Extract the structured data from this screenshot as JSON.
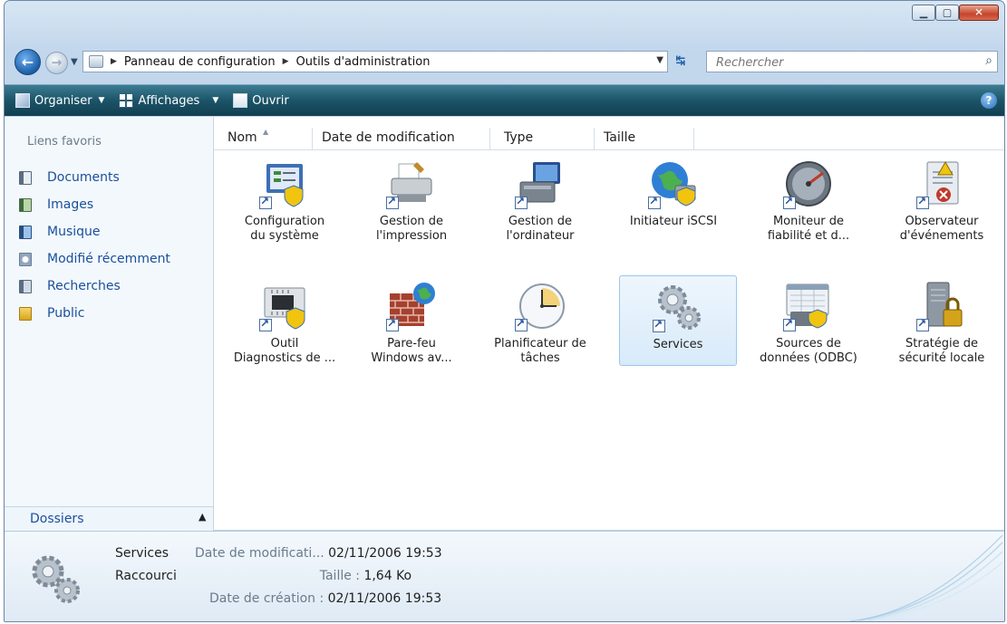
{
  "address": {
    "crumbs": [
      "Panneau de configuration",
      "Outils d'administration"
    ]
  },
  "search": {
    "placeholder": "Rechercher"
  },
  "toolbar": {
    "organize": "Organiser",
    "views": "Affichages",
    "open": "Ouvrir"
  },
  "sidebar": {
    "favorites_title": "Liens favoris",
    "items": [
      {
        "label": "Documents",
        "icon": "documents-icon"
      },
      {
        "label": "Images",
        "icon": "images-icon"
      },
      {
        "label": "Musique",
        "icon": "music-icon"
      },
      {
        "label": "Modifié récemment",
        "icon": "recent-icon"
      },
      {
        "label": "Recherches",
        "icon": "searches-icon"
      },
      {
        "label": "Public",
        "icon": "public-folder-icon"
      }
    ],
    "folders_label": "Dossiers"
  },
  "columns": [
    "Nom",
    "Date de modification",
    "Type",
    "Taille"
  ],
  "items": [
    {
      "line1": "Configuration",
      "line2": "du système",
      "icon": "system-config-icon"
    },
    {
      "line1": "Gestion de",
      "line2": "l'impression",
      "icon": "printer-icon"
    },
    {
      "line1": "Gestion de",
      "line2": "l'ordinateur",
      "icon": "computer-management-icon"
    },
    {
      "line1": "Initiateur iSCSI",
      "line2": "",
      "icon": "iscsi-globe-icon"
    },
    {
      "line1": "Moniteur de",
      "line2": "fiabilité et d...",
      "icon": "gauge-icon"
    },
    {
      "line1": "Observateur",
      "line2": "d'événements",
      "icon": "event-viewer-icon"
    },
    {
      "line1": "Outil",
      "line2": "Diagnostics de ...",
      "icon": "memory-diagnostic-icon"
    },
    {
      "line1": "Pare-feu",
      "line2": "Windows av...",
      "icon": "firewall-icon"
    },
    {
      "line1": "Planificateur de",
      "line2": "tâches",
      "icon": "clock-icon"
    },
    {
      "line1": "Services",
      "line2": "",
      "icon": "gears-icon",
      "selected": true
    },
    {
      "line1": "Sources de",
      "line2": "données (ODBC)",
      "icon": "odbc-icon"
    },
    {
      "line1": "Stratégie de",
      "line2": "sécurité locale",
      "icon": "server-lock-icon"
    }
  ],
  "details": {
    "name": "Services",
    "kind": "Raccourci",
    "modified_label": "Date de modificati...",
    "modified_value": "02/11/2006 19:53",
    "size_label": "Taille :",
    "size_value": "1,64 Ko",
    "created_label": "Date de création :",
    "created_value": "02/11/2006 19:53"
  },
  "colors": {
    "link": "#1a4f9c",
    "commandbar": "#1c5468",
    "selection": "#d8eaf9"
  }
}
